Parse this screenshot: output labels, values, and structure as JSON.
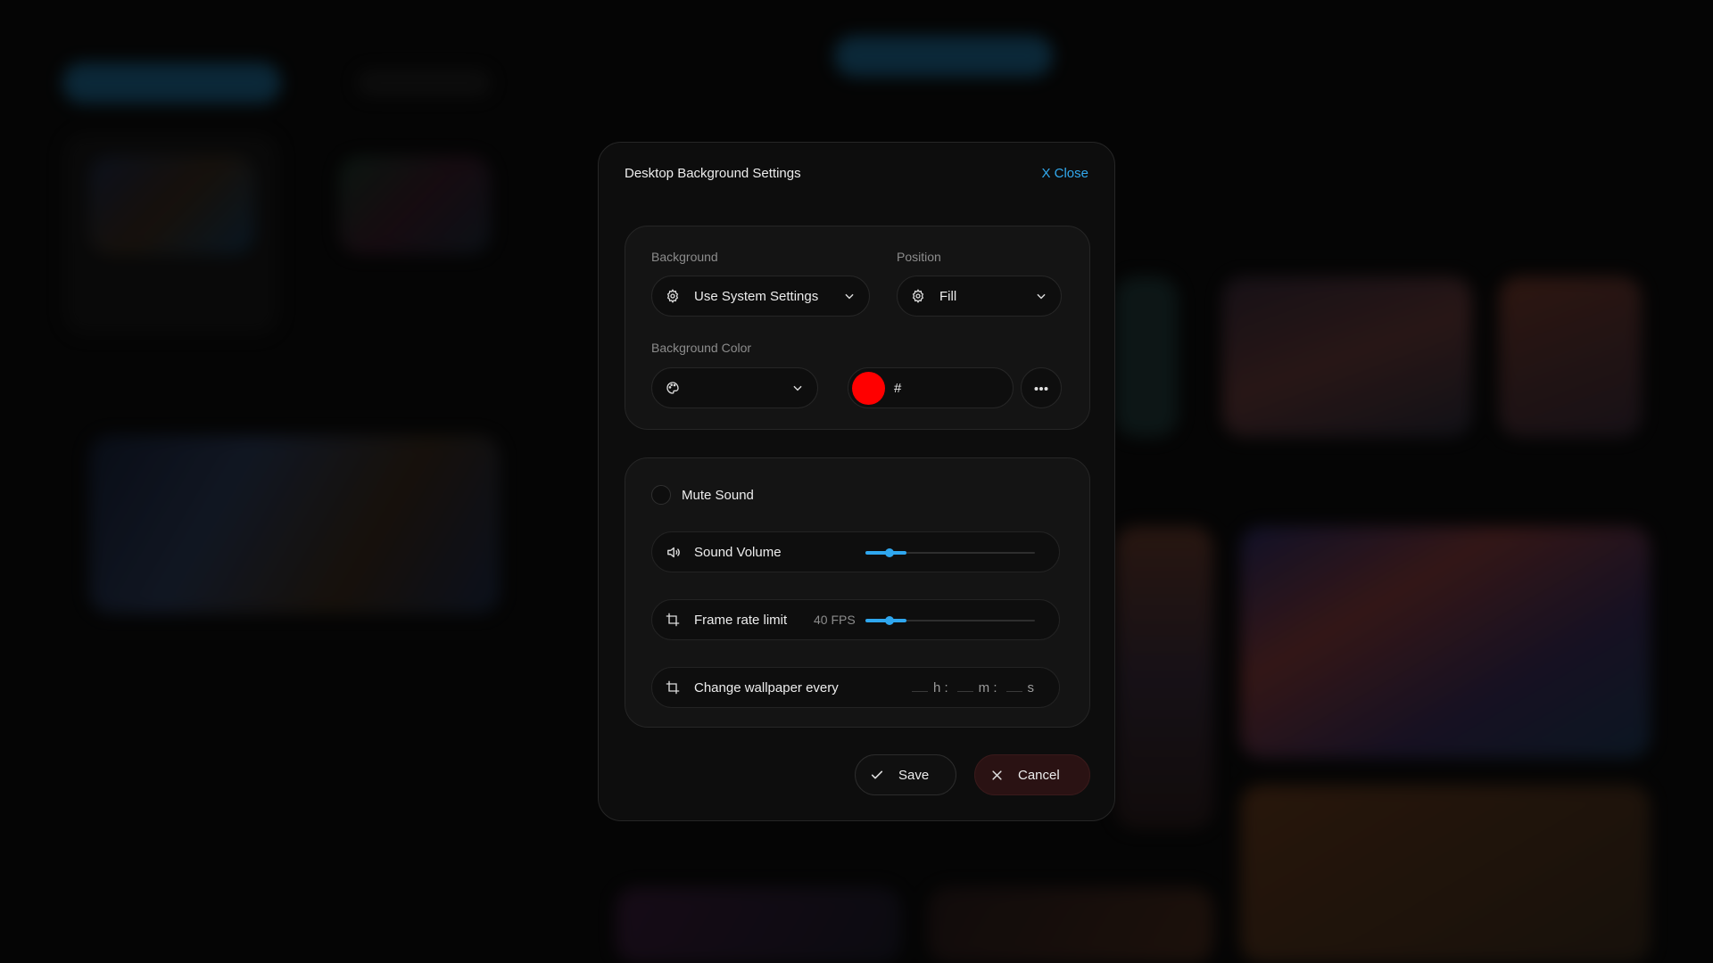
{
  "modal": {
    "title": "Desktop Background Settings",
    "close_label": "X Close"
  },
  "background": {
    "label": "Background",
    "value": "Use System Settings",
    "icon": "gear-icon"
  },
  "position": {
    "label": "Position",
    "value": "Fill",
    "icon": "gear-icon"
  },
  "background_color": {
    "label": "Background Color",
    "icon": "palette-icon",
    "swatch_color": "#ff0000",
    "hex_prefix": "#"
  },
  "mute": {
    "label": "Mute Sound",
    "checked": false
  },
  "sound_volume": {
    "label": "Sound Volume",
    "icon": "speaker-icon",
    "value_fraction": 0.14
  },
  "frame_rate": {
    "label": "Frame rate limit",
    "value_text": "40 FPS",
    "icon": "frame-icon",
    "value_fraction": 0.14
  },
  "change_wallpaper": {
    "label": "Change wallpaper every",
    "icon": "frame-icon",
    "hours_unit": "h :",
    "minutes_unit": "m :",
    "seconds_unit": "s"
  },
  "actions": {
    "save_label": "Save",
    "cancel_label": "Cancel"
  },
  "colors": {
    "accent": "#2fa7ef",
    "cancel_bg": "#2a1213",
    "swatch": "#ff0000"
  }
}
